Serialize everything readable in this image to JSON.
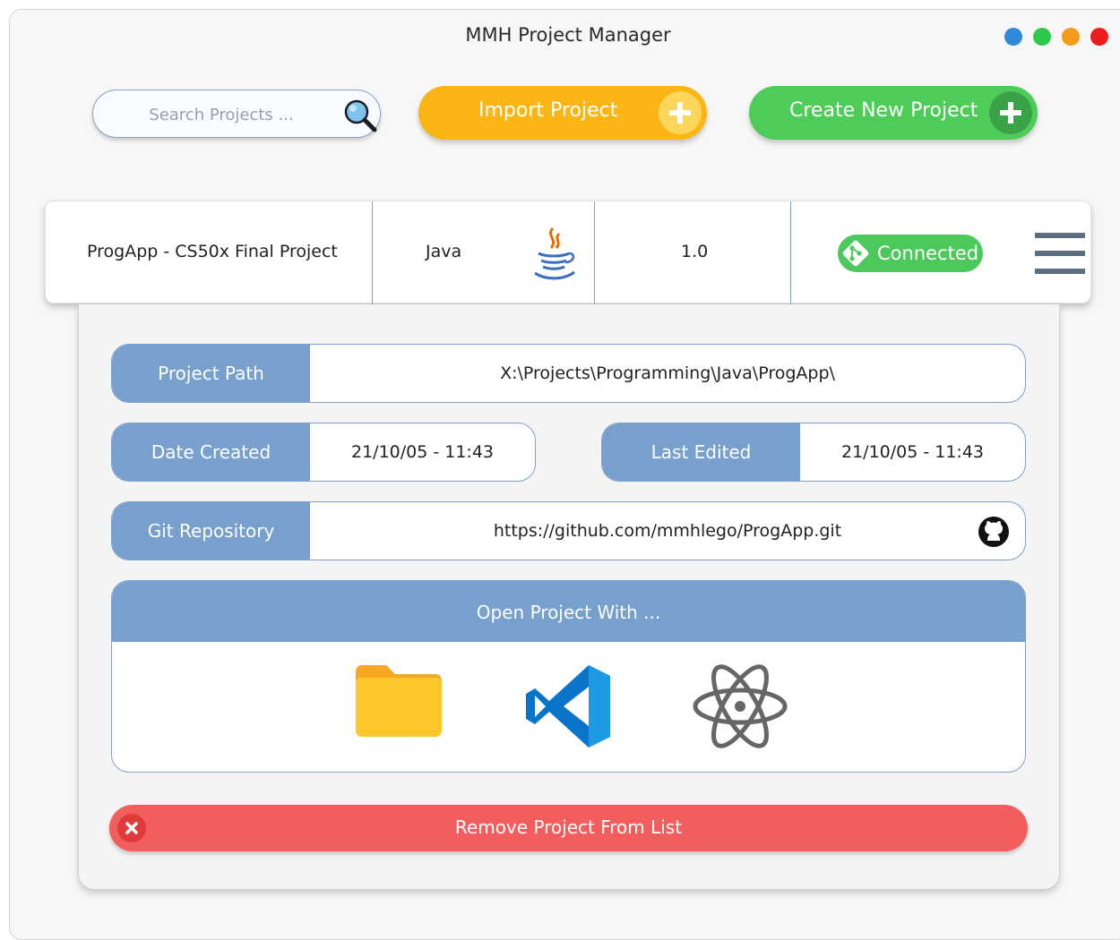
{
  "window": {
    "title": "MMH Project Manager",
    "controls": [
      {
        "name": "blue",
        "color": "#2e8ad8"
      },
      {
        "name": "green",
        "color": "#2ec84a"
      },
      {
        "name": "orange",
        "color": "#f59a1b"
      },
      {
        "name": "red",
        "color": "#ee1d1d"
      }
    ]
  },
  "toolbar": {
    "search_placeholder": "Search Projects ...",
    "search_icon": "magnifier-icon",
    "import_label": "Import Project",
    "import_color": "#fbb515",
    "create_label": "Create New Project",
    "create_color": "#4dcc58"
  },
  "project": {
    "name": "ProgApp - CS50x Final Project",
    "language": "Java",
    "language_icon": "java-icon",
    "version": "1.0",
    "git_status": "Connected",
    "menu_icon": "hamburger-menu-icon"
  },
  "details": {
    "path_label": "Project Path",
    "path_value": "X:\\Projects\\Programming\\Java\\ProgApp\\",
    "created_label": "Date Created",
    "created_value": "21/10/05 - 11:43",
    "edited_label": "Last Edited",
    "edited_value": "21/10/05 - 11:43",
    "git_label": "Git Repository",
    "git_value": "https://github.com/mmhlego/ProgApp.git",
    "git_icon": "github-icon"
  },
  "open_with": {
    "header": "Open Project With ...",
    "apps": [
      "folder-icon",
      "vscode-icon",
      "atom-icon"
    ]
  },
  "remove": {
    "label": "Remove Project From List",
    "color": "#f25e5e"
  }
}
